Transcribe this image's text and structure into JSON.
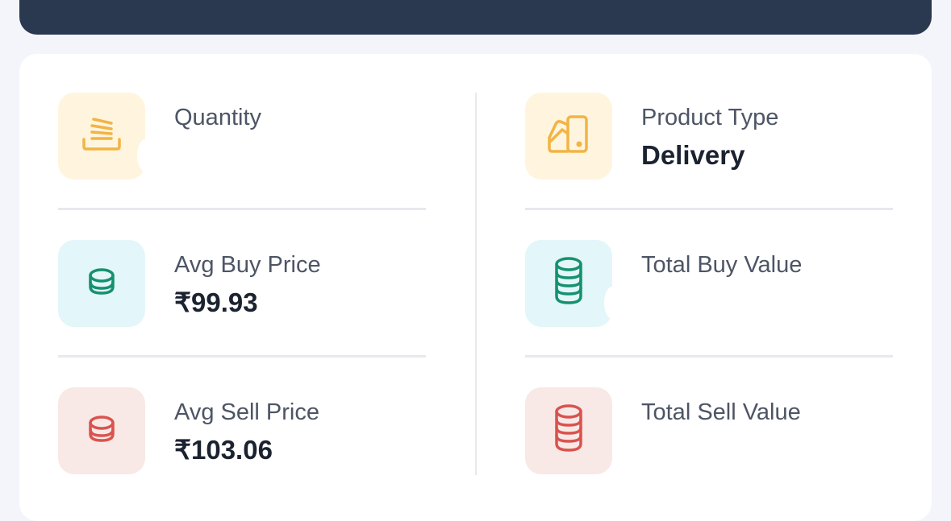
{
  "colors": {
    "banner": "#2a3950",
    "yellow_icon": "#f2b443",
    "green_icon": "#15916e",
    "red_icon": "#d9534f"
  },
  "stats": {
    "quantity": {
      "label": "Quantity",
      "value": "",
      "icon": "stack-icon"
    },
    "product_type": {
      "label": "Product Type",
      "value": "Delivery",
      "icon": "product-type-icon"
    },
    "avg_buy": {
      "label": "Avg Buy Price",
      "value": "₹99.93",
      "icon": "coin-icon"
    },
    "total_buy": {
      "label": "Total Buy Value",
      "value": "",
      "icon": "coin-stack-icon"
    },
    "avg_sell": {
      "label": "Avg Sell Price",
      "value": "₹103.06",
      "icon": "coin-icon"
    },
    "total_sell": {
      "label": "Total Sell Value",
      "value": "",
      "icon": "coin-stack-icon"
    }
  }
}
